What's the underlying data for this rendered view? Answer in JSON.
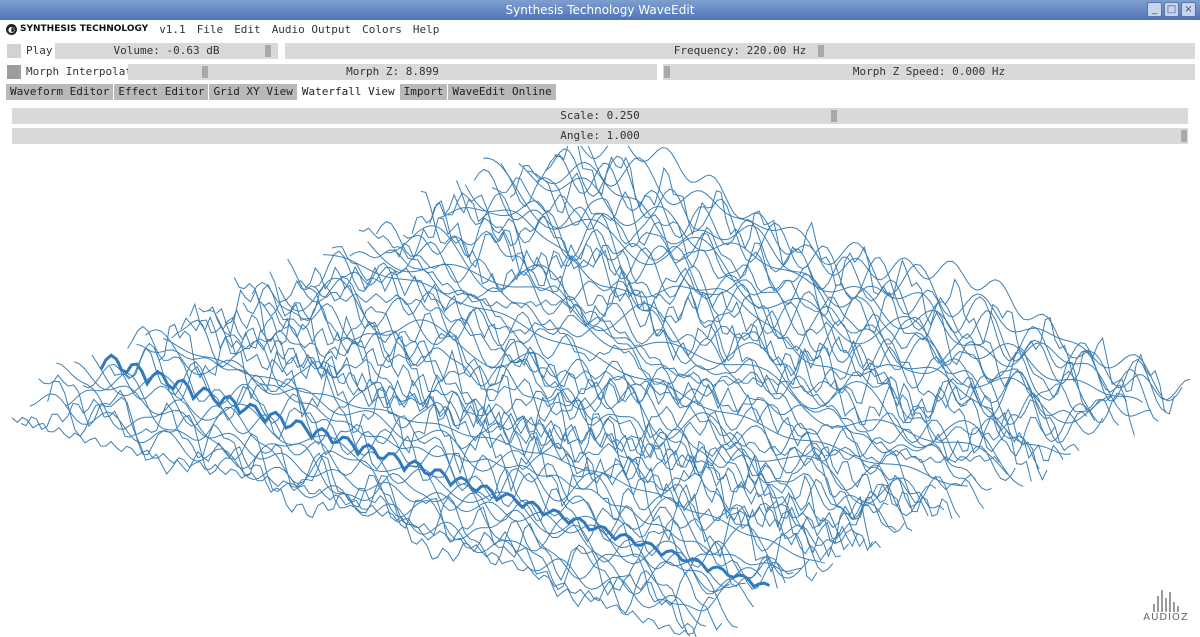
{
  "window": {
    "title": "Synthesis Technology WaveEdit",
    "controls": [
      "_",
      "□",
      "×"
    ]
  },
  "menubar": {
    "brand": "SYNTHESIS TECHNOLOGY",
    "version": "v1.1",
    "items": [
      "File",
      "Edit",
      "Audio Output",
      "Colors",
      "Help"
    ]
  },
  "controls": {
    "play_label": "Play",
    "volume": {
      "label": "Volume: -0.63 dB",
      "value_fraction": 0.97
    },
    "frequency": {
      "label": "Frequency: 220.00 Hz",
      "value_fraction": 0.59
    },
    "morph_interpolate_label": "Morph Interpolate",
    "morph_z": {
      "label": "Morph Z: 8.899",
      "value_fraction": 0.14
    },
    "morph_z_speed": {
      "label": "Morph Z Speed: 0.000 Hz",
      "value_fraction": 0.0
    }
  },
  "tabs": [
    "Waveform Editor",
    "Effect Editor",
    "Grid XY View",
    "Waterfall View",
    "Import",
    "WaveEdit Online"
  ],
  "active_tab": "Waterfall View",
  "view": {
    "scale": {
      "label": "Scale: 0.250",
      "value_fraction": 0.7
    },
    "angle": {
      "label": "Angle: 1.000",
      "value_fraction": 1.0
    }
  },
  "waterfall": {
    "wave_color": "#3c7fb4",
    "highlight_color": "#2f79bf",
    "wave_count": 64,
    "highlight_index": 10
  },
  "watermark": {
    "text": "AUDIOZ"
  }
}
